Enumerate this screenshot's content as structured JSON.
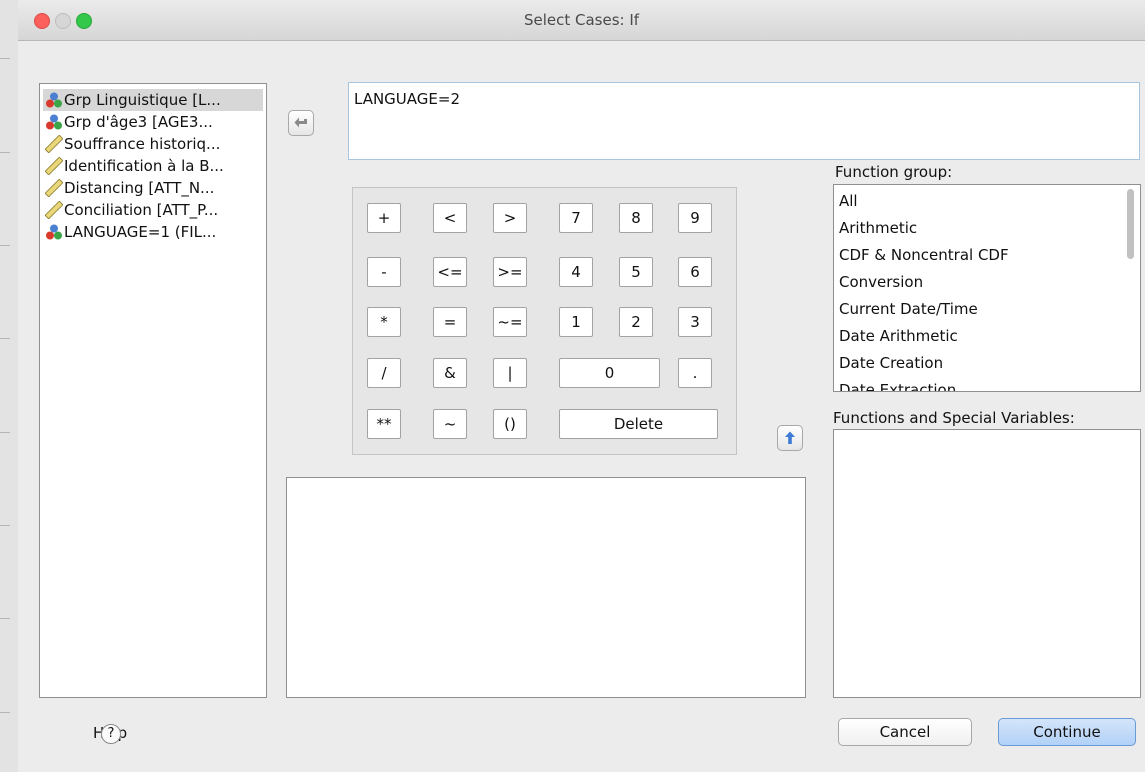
{
  "window": {
    "title": "Select Cases: If"
  },
  "variables": [
    {
      "label": "Grp Linguistique [L...",
      "icon": "nominal-icon",
      "selected": true
    },
    {
      "label": "Grp d'âge3 [AGE3...",
      "icon": "nominal-icon"
    },
    {
      "label": "Souffrance historiq...",
      "icon": "scale-ruler-icon"
    },
    {
      "label": "Identification à la B...",
      "icon": "scale-ruler-icon"
    },
    {
      "label": "Distancing [ATT_N...",
      "icon": "scale-ruler-icon"
    },
    {
      "label": "Conciliation [ATT_P...",
      "icon": "scale-ruler-icon"
    },
    {
      "label": "LANGUAGE=1 (FIL...",
      "icon": "nominal-icon"
    }
  ],
  "expression": {
    "value": "LANGUAGE=2"
  },
  "keypad": {
    "row1": [
      "+",
      "<",
      ">",
      "7",
      "8",
      "9"
    ],
    "row2": [
      "-",
      "<=",
      ">=",
      "4",
      "5",
      "6"
    ],
    "row3": [
      "*",
      "=",
      "~=",
      "1",
      "2",
      "3"
    ],
    "row4": [
      "/",
      "&",
      "|",
      "0",
      "."
    ],
    "row5": [
      "**",
      "~",
      "()",
      "Delete"
    ]
  },
  "function_group": {
    "label": "Function group:",
    "items": [
      "All",
      "Arithmetic",
      "CDF & Noncentral CDF",
      "Conversion",
      "Current Date/Time",
      "Date Arithmetic",
      "Date Creation",
      "Date Extraction"
    ]
  },
  "functions_special": {
    "label": "Functions and Special Variables:"
  },
  "buttons": {
    "help": "Help",
    "help_glyph": "?",
    "cancel": "Cancel",
    "continue": "Continue"
  },
  "colors": {
    "accent": "#b2d1f7",
    "close": "#fc605c",
    "maximize": "#34c84a"
  }
}
